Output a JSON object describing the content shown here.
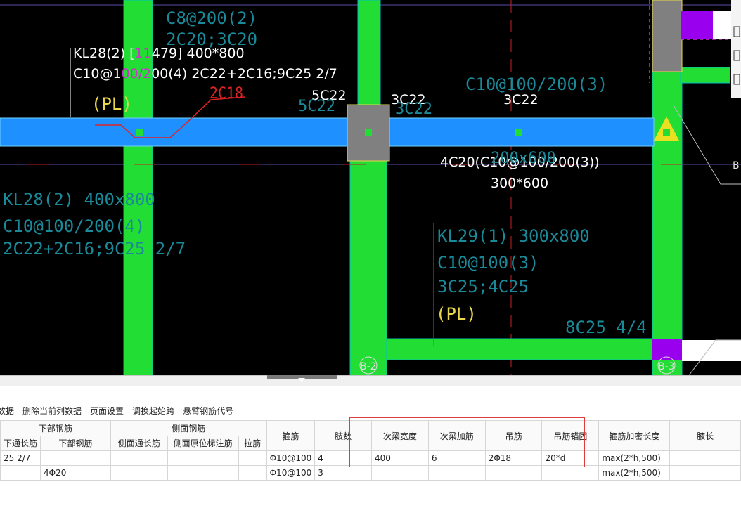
{
  "cad": {
    "beam_labels": {
      "kl28_top_line1": "KL28(2) [",
      "kl28_top_line1_mag": "11",
      "kl28_top_line1_rest": "479] 400*800",
      "kl28_top_line2a": "C10@1",
      "kl28_top_line2_mag": "00/2",
      "kl28_top_line2b": "00(4) 2C22+2C16;9C25 2/7",
      "pl1": "(PL)",
      "red_2c18": "2C18",
      "t_5c22": "5C22",
      "t_5c22_cyan": "5C22",
      "t_3c22_a": "3C22",
      "t_3c22_a_cyan": "3C22",
      "t_3c22_b": "3C22",
      "c8_top": "C8@200(2)",
      "c20_top": "2C20;3C20",
      "c10_3": "C10@100/200(3)",
      "stirrup_4c20": "4C20(C10@100/200(3))",
      "size_300_600": "300*600",
      "cyan_200_600": "200x600",
      "kl28_left_line1": "KL28(2) 400x800",
      "kl28_left_line2": "C10@100/200(4)",
      "kl28_left_line3": "2C22+2C16;9C25 2/7",
      "kl29_line1": "KL29(1) 300x800",
      "kl29_line2": "C10@100(3)",
      "kl29_line3": "3C25;4C25",
      "pl2": "(PL)",
      "bottom_8c25": "8C25 4/4",
      "axis_b2": "B-2",
      "axis_b3": "B-3",
      "edge_b": "B"
    },
    "colors": {
      "background": "#000000",
      "column_green": "#22dd33",
      "beam_blue": "#1e90ff",
      "column_gray": "#808080",
      "cyan_text": "#1a8a9a",
      "magenta": "#cc33cc",
      "red": "#dd2222",
      "yellow": "#e8d84a",
      "purple_fill": "#9900ee"
    }
  },
  "toolbar": {
    "items": [
      "数据",
      "删除当前列数据",
      "页面设置",
      "调换起始跨",
      "悬臂钢筋代号"
    ]
  },
  "table": {
    "group_headers": {
      "bottom_rebar": "下部钢筋",
      "side_rebar": "侧面钢筋"
    },
    "headers": {
      "bottom_through": "下通长筋",
      "bottom_rebar": "下部钢筋",
      "side_through": "侧面通长筋",
      "side_origin": "侧面原位标注筋",
      "tie": "拉筋",
      "stirrup": "箍筋",
      "legs": "肢数",
      "sec_width": "次梁宽度",
      "sec_add": "次梁加筋",
      "hanger": "吊筋",
      "hanger_anchor": "吊筋锚固",
      "stirrup_dense": "箍筋加密长度",
      "haunch": "腋长"
    },
    "rows": [
      {
        "bottom_through": "25 2/7",
        "bottom_rebar": "",
        "side_through": "",
        "side_origin": "",
        "tie": "",
        "stirrup": "Φ10@100",
        "legs": "4",
        "sec_width": "400",
        "sec_add": "6",
        "hanger": "2Φ18",
        "hanger_anchor": "20*d",
        "stirrup_dense": "max(2*h,500)",
        "haunch": ""
      },
      {
        "bottom_through": "",
        "bottom_rebar": "4Φ20",
        "side_through": "",
        "side_origin": "",
        "tie": "",
        "stirrup": "Φ10@100",
        "legs": "3",
        "sec_width": "",
        "sec_add": "",
        "hanger": "",
        "hanger_anchor": "",
        "stirrup_dense": "max(2*h,500)",
        "haunch": ""
      }
    ]
  }
}
